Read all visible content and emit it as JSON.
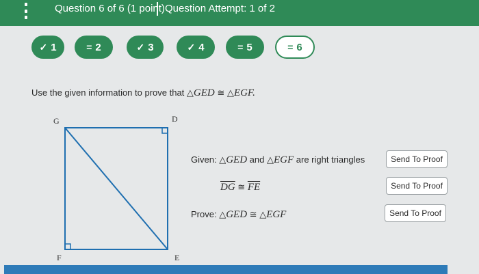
{
  "header": {
    "title": "Question 6 of 6 (1 point)",
    "attempt": "Question Attempt: 1 of 2"
  },
  "question_nav": [
    {
      "symbol": "✓",
      "number": "1",
      "status": "correct"
    },
    {
      "symbol": "=",
      "number": "2",
      "status": "partial"
    },
    {
      "symbol": "✓",
      "number": "3",
      "status": "correct"
    },
    {
      "symbol": "✓",
      "number": "4",
      "status": "correct"
    },
    {
      "symbol": "=",
      "number": "5",
      "status": "partial"
    },
    {
      "symbol": "=",
      "number": "6",
      "status": "current"
    }
  ],
  "prompt": {
    "text": "Use the given information to prove that",
    "tri1": "△",
    "name1": "GED",
    "congruent": "≅",
    "tri2": "△",
    "name2": "EGF."
  },
  "diagram": {
    "labels": {
      "G": "G",
      "D": "D",
      "F": "F",
      "E": "E"
    }
  },
  "given": {
    "prefix": "Given:",
    "tri1": "△",
    "name1": "GED",
    "mid": "and",
    "tri2": "△",
    "name2": "EGF",
    "suffix": "are right triangles"
  },
  "statement2": {
    "seg1": "DG",
    "congruent": "≅",
    "seg2": "FE"
  },
  "prove": {
    "prefix": "Prove:",
    "tri1": "△",
    "name1": "GED",
    "congruent": "≅",
    "tri2": "△",
    "name2": "EGF"
  },
  "buttons": {
    "send1": "Send To Proof",
    "send2": "Send To Proof",
    "send3": "Send To Proof"
  },
  "colors": {
    "accent": "#2f8a57",
    "bottom_bar": "#2e7bb8",
    "diagram_line": "#1f6fb0"
  }
}
